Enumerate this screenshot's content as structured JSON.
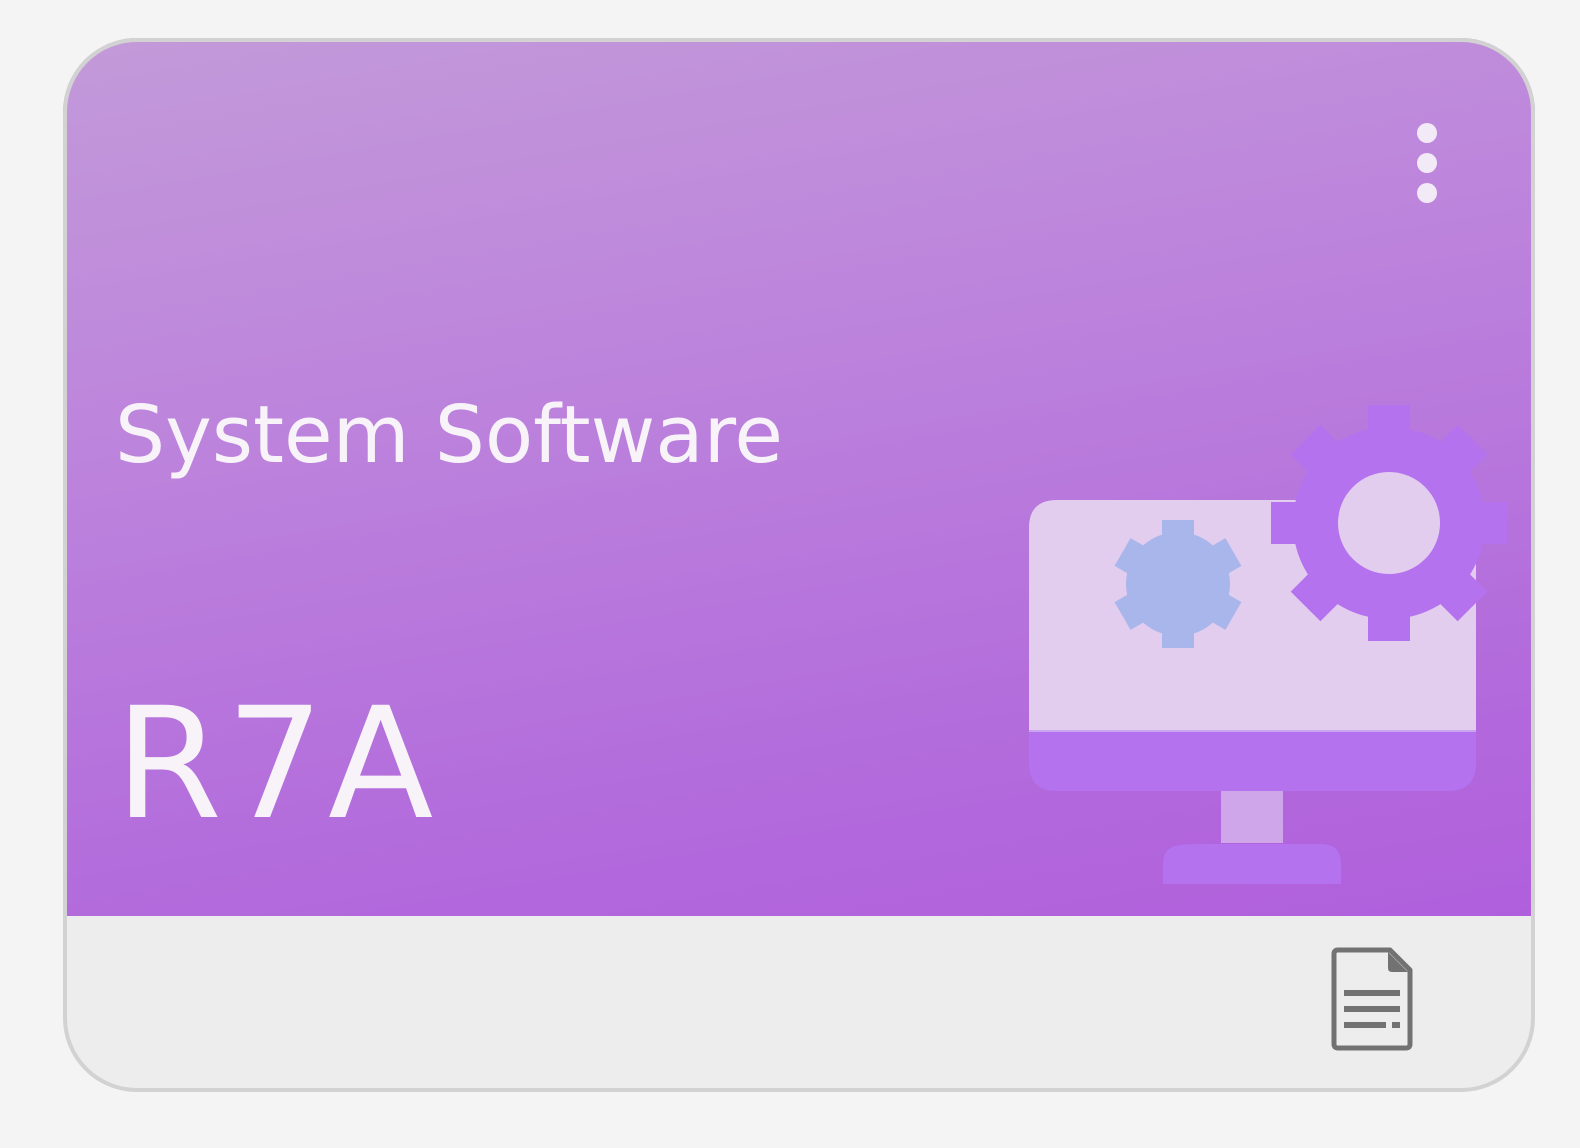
{
  "card": {
    "title": "System Software",
    "code": "R7A",
    "banner_colors": [
      "#c39ad9",
      "#b05fdc"
    ]
  },
  "icons": {
    "menu": "more-vertical-icon",
    "illustration": "monitor-gears-icon",
    "file": "document-icon"
  }
}
